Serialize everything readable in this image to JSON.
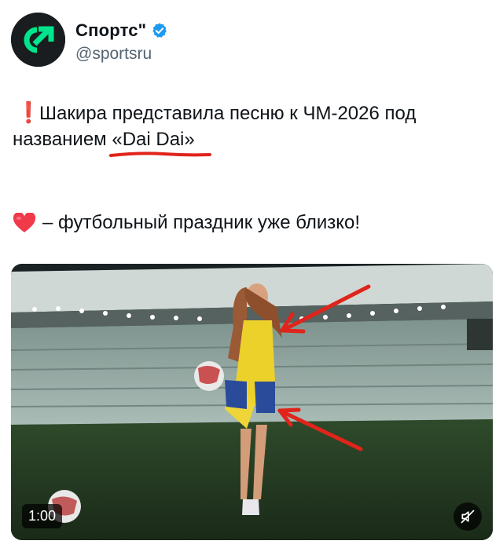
{
  "account": {
    "display_name": "Спортс\"",
    "handle": "@sportsru",
    "avatar_icon": "sports-logo-icon",
    "verified_icon": "verified-badge-icon",
    "brand_color": "#00e58d",
    "verified_color": "#1d9bf0"
  },
  "post": {
    "line1_text": "Шакира представила песню к ЧМ-2026 под",
    "line2_text": "названием «Dai Dai»",
    "line3_text": "– футбольный праздник уже близко!",
    "exclaim_icon": "red-exclamation-icon",
    "heart_icon": "red-heart-icon",
    "exclaim_glyph": "❗"
  },
  "video": {
    "duration": "1:00",
    "mute_icon": "muted-speaker-icon",
    "annotation_color": "#e0241b"
  }
}
